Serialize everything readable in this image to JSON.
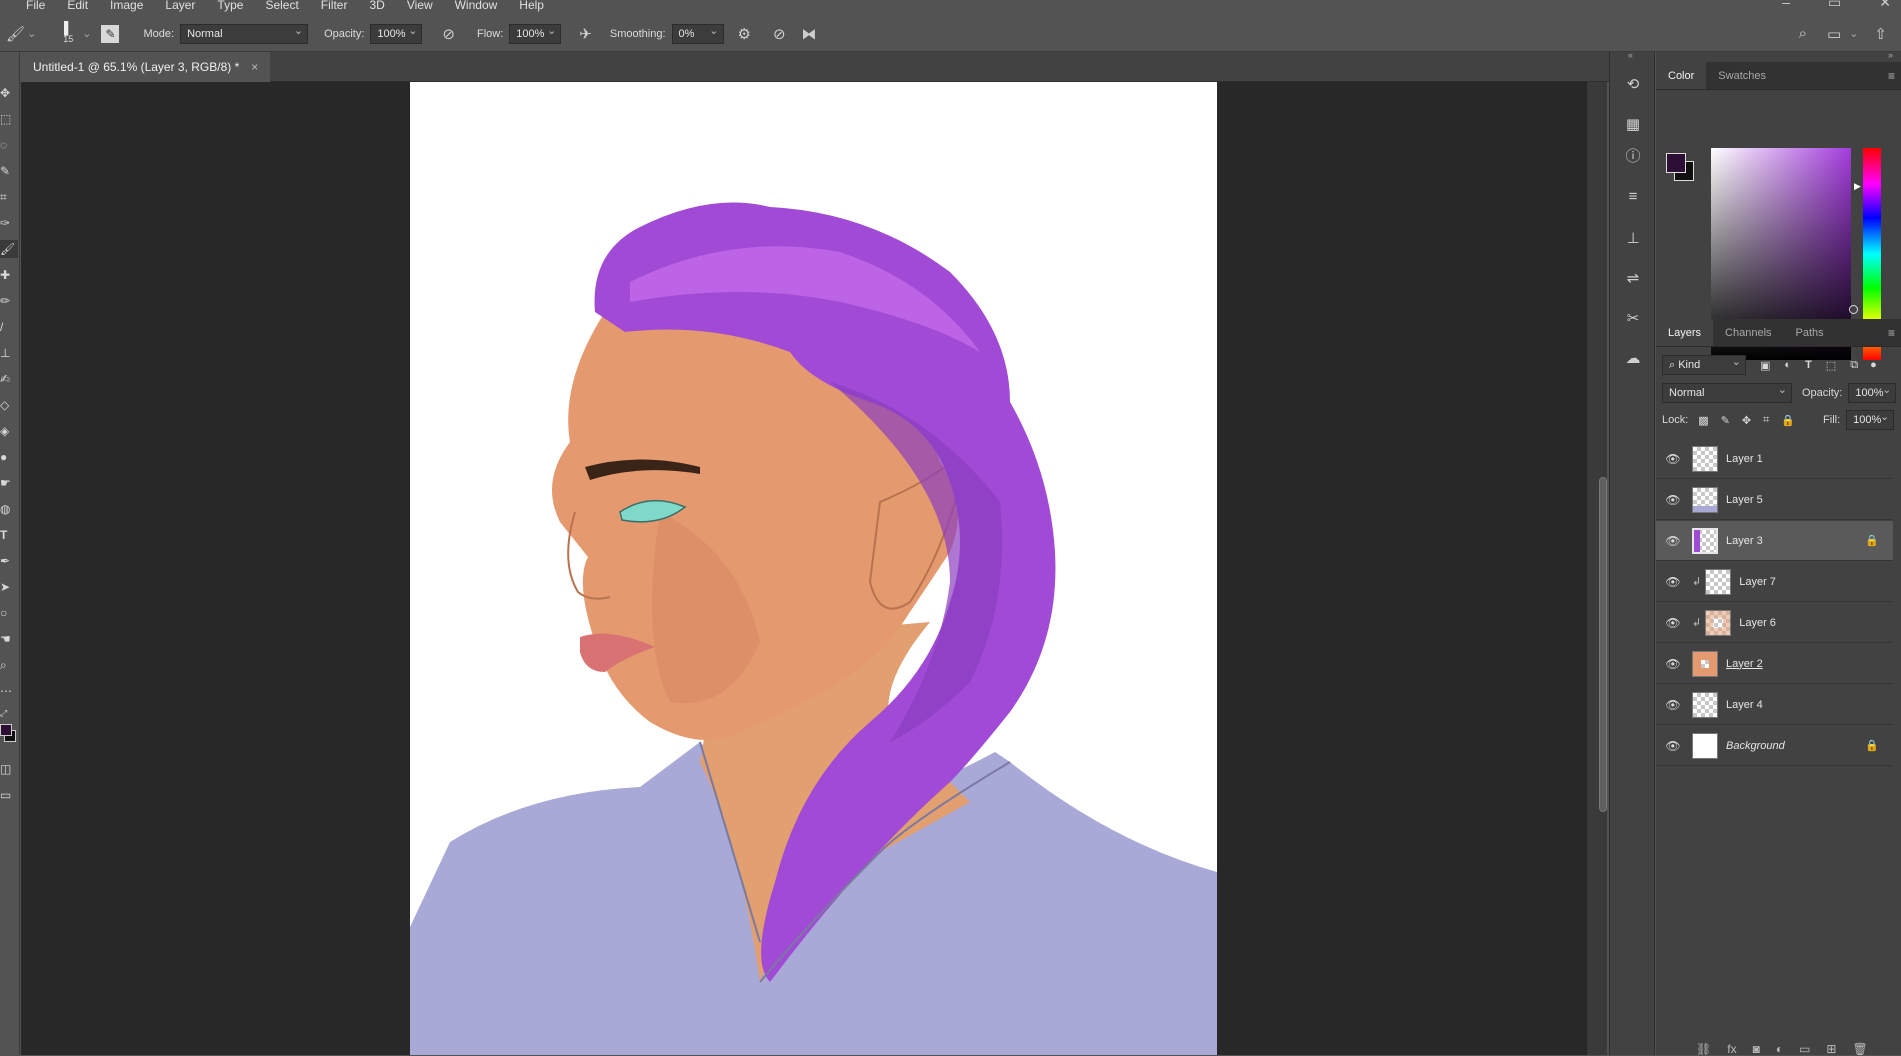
{
  "menu": [
    "File",
    "Edit",
    "Image",
    "Layer",
    "Type",
    "Select",
    "Filter",
    "3D",
    "View",
    "Window",
    "Help"
  ],
  "options": {
    "brush_size": "15",
    "mode_label": "Mode:",
    "mode_value": "Normal",
    "opacity_label": "Opacity:",
    "opacity_value": "100%",
    "flow_label": "Flow:",
    "flow_value": "100%",
    "smoothing_label": "Smoothing:",
    "smoothing_value": "0%"
  },
  "document": {
    "tab_title": "Untitled-1 @ 65.1% (Layer 3, RGB/8) *",
    "close": "×"
  },
  "color_panel": {
    "tabs": [
      "Color",
      "Swatches"
    ],
    "foreground": "#2d0f35",
    "background": "#101010"
  },
  "layers_panel": {
    "tabs": [
      "Layers",
      "Channels",
      "Paths"
    ],
    "filter_kind": "Kind",
    "blend_mode": "Normal",
    "opacity_label": "Opacity:",
    "opacity_value": "100%",
    "lock_label": "Lock:",
    "fill_label": "Fill:",
    "fill_value": "100%",
    "layers": [
      {
        "name": "Layer 1"
      },
      {
        "name": "Layer 5"
      },
      {
        "name": "Layer 3"
      },
      {
        "name": "Layer 7"
      },
      {
        "name": "Layer 6"
      },
      {
        "name": "Layer 2"
      },
      {
        "name": "Layer 4"
      },
      {
        "name": "Background"
      }
    ]
  },
  "colors": {
    "accent_hair": "#a04ad6",
    "shirt": "#a9a9d8",
    "skin": "#e49a6e",
    "eye": "#7fd9c8"
  }
}
